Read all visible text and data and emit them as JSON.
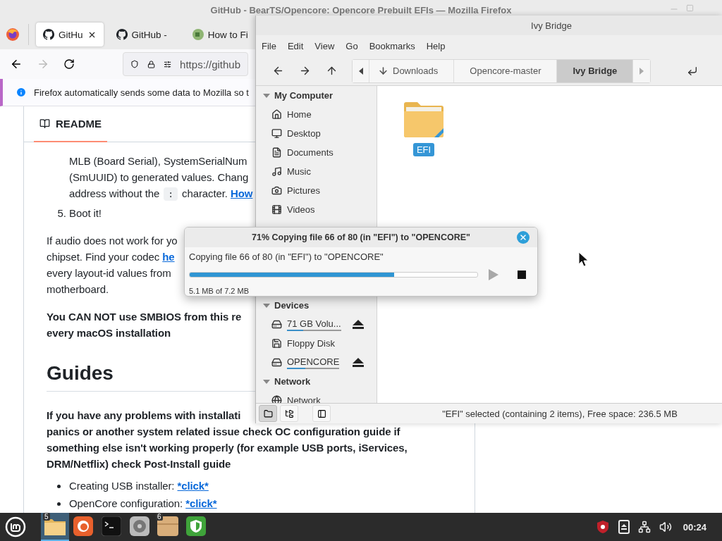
{
  "browser": {
    "title": "GitHub - BearTS/Opencore: Opencore Prebuilt EFIs — Mozilla Firefox",
    "forward_disabled": true,
    "tabs": [
      {
        "label": "GitHu",
        "selected": true
      },
      {
        "label": "GitHub -",
        "selected": false
      },
      {
        "label": "How to Fi",
        "selected": false
      }
    ],
    "url": "https://github",
    "notice": "Firefox automatically sends some data to Mozilla so t",
    "readme": {
      "label": "README",
      "blocks": [
        {
          "kind": "ordered_item",
          "lines": [
            [
              {
                "kind": "text",
                "text": "MLB (Board Serial), SystemSerialNum"
              }
            ],
            [
              {
                "kind": "text",
                "text": "(SmUUID) to generated values. Chang"
              }
            ],
            [
              {
                "kind": "text",
                "text": "address without the "
              },
              {
                "kind": "code",
                "text": ":"
              },
              {
                "kind": "text",
                "text": " character. "
              },
              {
                "kind": "link",
                "text": "How"
              }
            ]
          ]
        },
        {
          "kind": "ordered_item",
          "number": "5.",
          "lines": [
            [
              {
                "kind": "text",
                "text": "Boot it!"
              }
            ]
          ]
        },
        {
          "kind": "paragraph",
          "lines": [
            [
              {
                "kind": "text",
                "text": "If audio does not work for yo"
              }
            ],
            [
              {
                "kind": "text",
                "text": "chipset. Find your codec "
              },
              {
                "kind": "link",
                "text": "he"
              }
            ],
            [
              {
                "kind": "text",
                "text": "every layout-id values from"
              }
            ],
            [
              {
                "kind": "text",
                "text": "motherboard."
              }
            ]
          ]
        },
        {
          "kind": "bold_paragraph",
          "lines": [
            [
              {
                "kind": "text",
                "text": "You CAN NOT use SMBIOS from this re"
              }
            ],
            [
              {
                "kind": "text",
                "text": "every macOS installation"
              }
            ]
          ]
        },
        {
          "kind": "heading",
          "lines": [
            [
              {
                "kind": "text",
                "text": "Guides"
              }
            ]
          ]
        },
        {
          "kind": "bold_paragraph",
          "lines": [
            [
              {
                "kind": "text",
                "text": "If you have any problems with installati"
              }
            ],
            [
              {
                "kind": "text",
                "text": "panics or another system related issue check OC configuration guide if"
              }
            ],
            [
              {
                "kind": "text",
                "text": "something else isn't working properly (for example USB ports, iServices,"
              }
            ],
            [
              {
                "kind": "text",
                "text": "DRM/Netflix) check Post-Install guide"
              }
            ]
          ]
        },
        {
          "kind": "bullet",
          "lines": [
            [
              {
                "kind": "text",
                "text": "Creating USB installer: "
              },
              {
                "kind": "link",
                "text": "*click*"
              }
            ]
          ]
        },
        {
          "kind": "bullet",
          "lines": [
            [
              {
                "kind": "text",
                "text": "OpenCore configuration: "
              },
              {
                "kind": "link",
                "text": "*click*"
              }
            ]
          ]
        }
      ]
    }
  },
  "file_manager": {
    "title": "Ivy Bridge",
    "menu": [
      "File",
      "Edit",
      "View",
      "Go",
      "Bookmarks",
      "Help"
    ],
    "path": [
      {
        "label": "Downloads",
        "kind": "downloads",
        "selected": false
      },
      {
        "label": "Opencore-master",
        "kind": "folder",
        "selected": false
      },
      {
        "label": "Ivy Bridge",
        "kind": "folder",
        "selected": true
      }
    ],
    "sidebar": [
      {
        "label": "My Computer",
        "expanded": true,
        "items": [
          {
            "label": "Home",
            "kind": "home"
          },
          {
            "label": "Desktop",
            "kind": "desktop"
          },
          {
            "label": "Documents",
            "kind": "documents"
          },
          {
            "label": "Music",
            "kind": "music"
          },
          {
            "label": "Pictures",
            "kind": "pictures"
          },
          {
            "label": "Videos",
            "kind": "videos"
          }
        ]
      },
      {
        "label": "Devices",
        "expanded": true,
        "items": [
          {
            "label": "71 GB Volu...",
            "kind": "drive",
            "level": 0.3,
            "ejectable": true
          },
          {
            "label": "Floppy Disk",
            "kind": "floppy",
            "ejectable": false
          },
          {
            "label": "OPENCORE",
            "kind": "drive",
            "level": 0.35,
            "ejectable": true
          }
        ]
      },
      {
        "label": "Network",
        "expanded": true,
        "items": [
          {
            "label": "Network",
            "kind": "network"
          }
        ]
      }
    ],
    "files": [
      {
        "name": "EFI",
        "selected": true
      }
    ],
    "view_buttons": [
      {
        "kind": "places",
        "selected": true
      },
      {
        "kind": "tree",
        "selected": false
      },
      {
        "kind": "toggle",
        "selected": false
      }
    ],
    "status": "\"EFI\" selected (containing 2 items), Free space: 236.5 MB"
  },
  "copy_dialog": {
    "title": "71% Copying file 66 of 80 (in \"EFI\") to \"OPENCORE\"",
    "detail": "Copying file 66 of 80 (in \"EFI\") to \"OPENCORE\"",
    "level": 0.71,
    "size": "5.1 MB of 7.2 MB"
  },
  "taskbar": {
    "apps": [
      {
        "kind": "files",
        "badge": "5",
        "selected": true
      },
      {
        "kind": "browser",
        "selected": false
      },
      {
        "kind": "terminal",
        "selected": false
      },
      {
        "kind": "disks",
        "selected": false
      },
      {
        "kind": "archive",
        "badge": "6",
        "selected": false
      },
      {
        "kind": "shield",
        "selected": false
      }
    ],
    "clock": "00:24"
  }
}
